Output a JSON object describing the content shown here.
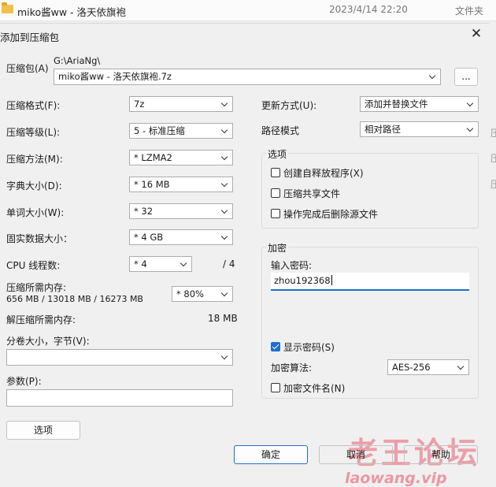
{
  "background": {
    "file_name": "miko酱ww - 洛天依旗袍",
    "date": "2023/4/14 22:20",
    "type": "文件夹",
    "side_fragments": [
      "压",
      "压",
      "压"
    ]
  },
  "dialog": {
    "title": "添加到压缩包",
    "archive_label": "压缩包(A)",
    "archive_path": "G:\\AriaNg\\",
    "archive_name": "miko酱ww - 洛天依旗袍.7z",
    "browse_label": "...",
    "format_label": "压缩格式(F):",
    "format_value": "7z",
    "level_label": "压缩等级(L):",
    "level_value": "5 - 标准压缩",
    "method_label": "压缩方法(M):",
    "method_value": "*  LZMA2",
    "dict_label": "字典大小(D):",
    "dict_value": "*  16 MB",
    "word_label": "单词大小(W):",
    "word_value": "*  32",
    "solid_label": "固实数据大小：",
    "solid_value": "*  4 GB",
    "threads_label": "CPU 线程数:",
    "threads_value": "*  4",
    "threads_total": "/ 4",
    "mem_label": "压缩所需内存:",
    "mem_values": "656 MB / 13018 MB / 16273 MB",
    "mem_percent": "* 80%",
    "decomp_label": "解压缩所需内存:",
    "decomp_value": "18 MB",
    "split_label": "分卷大小，字节(V):",
    "split_value": "",
    "params_label": "参数(P):",
    "params_value": "",
    "options_button": "选项",
    "update_label": "更新方式(U):",
    "update_value": "添加并替换文件",
    "path_label": "路径模式",
    "path_value": "相对路径",
    "options_group": {
      "title": "选项",
      "items": [
        {
          "label": "创建自释放程序(X)",
          "checked": false
        },
        {
          "label": "压缩共享文件",
          "checked": false
        },
        {
          "label": "操作完成后删除源文件",
          "checked": false
        }
      ]
    },
    "encryption": {
      "title": "加密",
      "password_label": "输入密码:",
      "password_value": "zhou192368",
      "show_password_label": "显示密码(S)",
      "show_password_checked": true,
      "method_label": "加密算法:",
      "method_value": "AES-256",
      "encrypt_names_label": "加密文件名(N)",
      "encrypt_names_checked": false
    },
    "ok_button": "确定",
    "cancel_button": "取消",
    "help_button": "帮助"
  },
  "watermark": {
    "line1": "老王论坛",
    "line2": "laowang.vip"
  }
}
